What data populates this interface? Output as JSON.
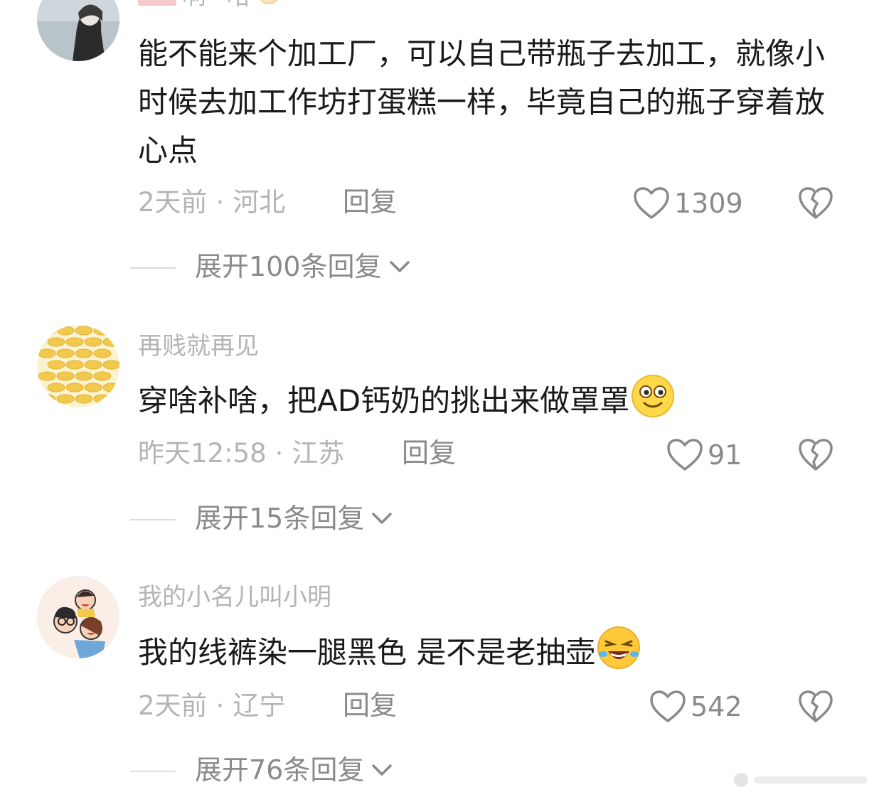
{
  "comments": [
    {
      "username": "啊~哈",
      "text": "能不能来个加工厂，可以自己带瓶子去加工，就像小时候去加工作坊打蛋糕一样，毕竟自己的瓶子穿着放心点",
      "time": "2天前",
      "location": "河北",
      "reply_label": "回复",
      "likes": "1309",
      "expand_label": "展开100条回复"
    },
    {
      "username": "再贱就再见",
      "text": "穿啥补啥，把AD钙奶的挑出来做罩罩",
      "time": "昨天12:58",
      "location": "江苏",
      "reply_label": "回复",
      "likes": "91",
      "expand_label": "展开15条回复"
    },
    {
      "username": "我的小名儿叫小明",
      "text": "我的线裤染一腿黑色  是不是老抽壶",
      "time": "2天前",
      "location": "辽宁",
      "reply_label": "回复",
      "likes": "542",
      "expand_label": "展开76条回复"
    }
  ],
  "icons": {
    "like": "heart-outline-icon",
    "dislike": "broken-heart-icon",
    "expand": "chevron-down-icon",
    "emoji_smile": "smiling-face-emoji",
    "emoji_laugh": "rolling-laughing-emoji"
  },
  "colors": {
    "text_primary": "#1a1a1a",
    "text_secondary": "#b4b4b4",
    "text_action": "#8a8a8a",
    "divider": "#dcdcdc"
  }
}
